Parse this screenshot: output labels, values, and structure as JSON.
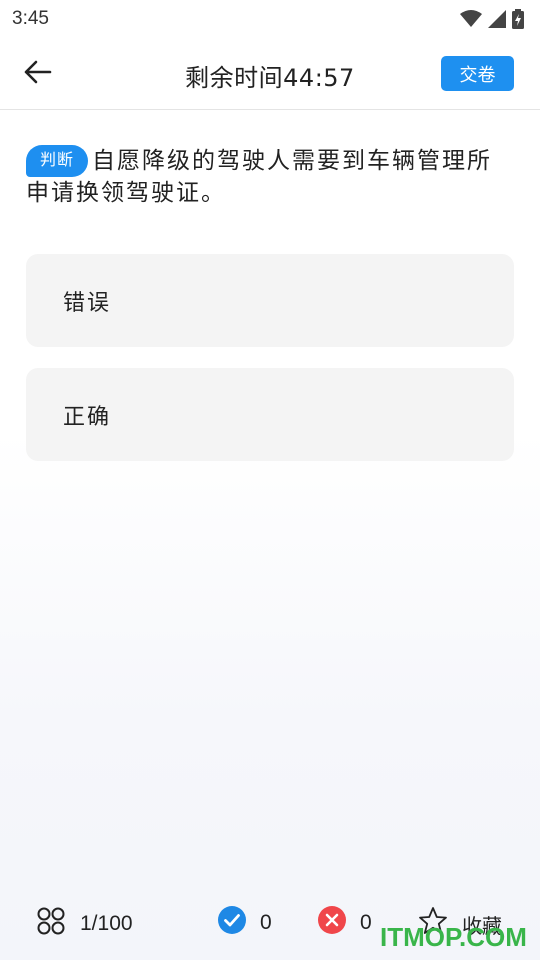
{
  "status_bar": {
    "time": "3:45",
    "icons": [
      "wifi-icon",
      "cellular-signal-icon",
      "battery-charging-icon"
    ]
  },
  "header": {
    "back_icon": "arrow-left-icon",
    "title": "剩余时间44:57",
    "submit_label": "交卷"
  },
  "question": {
    "type_label": "判断",
    "text": "自愿降级的驾驶人需要到车辆管理所申请换领驾驶证。"
  },
  "options": [
    {
      "label": "错误"
    },
    {
      "label": "正确"
    }
  ],
  "bottom_bar": {
    "progress": "1/100",
    "progress_icon": "question-grid-icon",
    "correct_count": "0",
    "correct_icon": "check-circle-icon",
    "wrong_count": "0",
    "wrong_icon": "close-circle-icon",
    "favorite_label": "收藏",
    "favorite_icon": "star-outline-icon"
  },
  "watermark": "ITMOP.COM",
  "colors": {
    "accent": "#1e90f0",
    "correct": "#1e88e5",
    "wrong": "#f0464a",
    "option_bg": "#f4f4f4",
    "watermark": "#39b54a"
  }
}
